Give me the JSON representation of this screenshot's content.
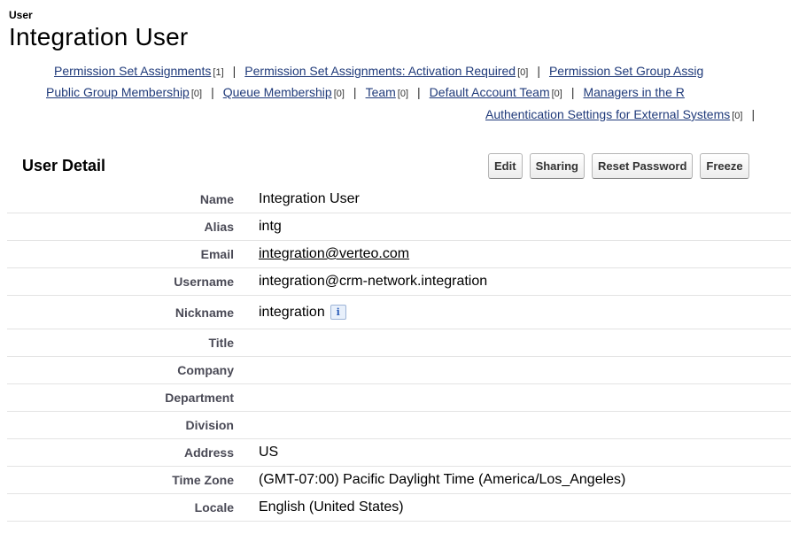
{
  "header": {
    "object_type": "User",
    "title": "Integration User"
  },
  "related_lists": {
    "row1": [
      {
        "label": "Permission Set Assignments",
        "count": "[1]"
      },
      {
        "label": "Permission Set Assignments: Activation Required",
        "count": "[0]"
      },
      {
        "label": "Permission Set Group Assig",
        "count": ""
      }
    ],
    "row2": [
      {
        "label": "Public Group Membership",
        "count": "[0]"
      },
      {
        "label": "Queue Membership",
        "count": "[0]"
      },
      {
        "label": "Team",
        "count": "[0]"
      },
      {
        "label": "Default Account Team",
        "count": "[0]"
      },
      {
        "label": "Managers in the R",
        "count": ""
      }
    ],
    "row3": [
      {
        "label": "Authentication Settings for External Systems",
        "count": "[0]"
      }
    ],
    "separator": "|"
  },
  "detail": {
    "section_title": "User Detail",
    "buttons": {
      "edit": "Edit",
      "sharing": "Sharing",
      "reset_password": "Reset Password",
      "freeze": "Freeze"
    },
    "fields": {
      "name": {
        "label": "Name",
        "value": "Integration User"
      },
      "alias": {
        "label": "Alias",
        "value": "intg"
      },
      "email": {
        "label": "Email",
        "value": "integration@verteo.com"
      },
      "username": {
        "label": "Username",
        "value": "integration@crm-network.integration"
      },
      "nickname": {
        "label": "Nickname",
        "value": "integration",
        "info_icon": "i"
      },
      "title": {
        "label": "Title",
        "value": ""
      },
      "company": {
        "label": "Company",
        "value": ""
      },
      "department": {
        "label": "Department",
        "value": ""
      },
      "division": {
        "label": "Division",
        "value": ""
      },
      "address": {
        "label": "Address",
        "value": "US"
      },
      "time_zone": {
        "label": "Time Zone",
        "value": "(GMT-07:00) Pacific Daylight Time (America/Los_Angeles)"
      },
      "locale": {
        "label": "Locale",
        "value": "English (United States)"
      }
    }
  }
}
